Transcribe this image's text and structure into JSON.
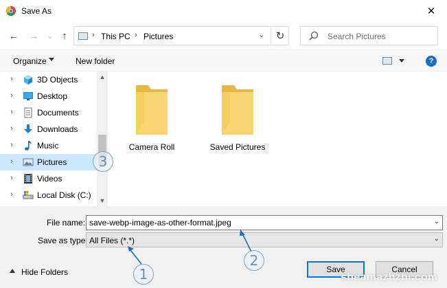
{
  "window": {
    "title": "Save As",
    "close_glyph": "✕"
  },
  "nav": {
    "back_glyph": "←",
    "forward_glyph": "→",
    "recent_glyph": "⌄",
    "up_glyph": "↑",
    "breadcrumb": [
      "This PC",
      "Pictures"
    ],
    "refresh_glyph": "↻",
    "search_placeholder": "Search Pictures"
  },
  "toolbar": {
    "organize": "Organize",
    "new_folder": "New folder",
    "help": "?"
  },
  "sidebar": {
    "items": [
      {
        "label": "3D Objects",
        "icon": "3d-objects-icon"
      },
      {
        "label": "Desktop",
        "icon": "desktop-icon"
      },
      {
        "label": "Documents",
        "icon": "documents-icon"
      },
      {
        "label": "Downloads",
        "icon": "downloads-icon"
      },
      {
        "label": "Music",
        "icon": "music-icon"
      },
      {
        "label": "Pictures",
        "icon": "pictures-icon",
        "selected": true
      },
      {
        "label": "Videos",
        "icon": "videos-icon"
      },
      {
        "label": "Local Disk (C:)",
        "icon": "drive-icon"
      }
    ]
  },
  "content": {
    "folders": [
      {
        "label": "Camera Roll"
      },
      {
        "label": "Saved Pictures"
      }
    ]
  },
  "form": {
    "file_name_label": "File name:",
    "file_name_value": "save-webp-image-as-other-format.jpeg",
    "save_type_label": "Save as type:",
    "save_type_value": "All Files (*.*)",
    "dropdown_glyph": "⌄"
  },
  "footer": {
    "hide_folders": "Hide Folders",
    "save": "Save",
    "cancel": "Cancel"
  },
  "annotations": {
    "c1": "1",
    "c2": "2",
    "c3": "3",
    "watermark": "sheamazhzhi.com"
  },
  "colors": {
    "accent": "#0078d7",
    "selected": "#cce8ff",
    "folder": "#f8d675",
    "callout": "#7aa0c8"
  }
}
